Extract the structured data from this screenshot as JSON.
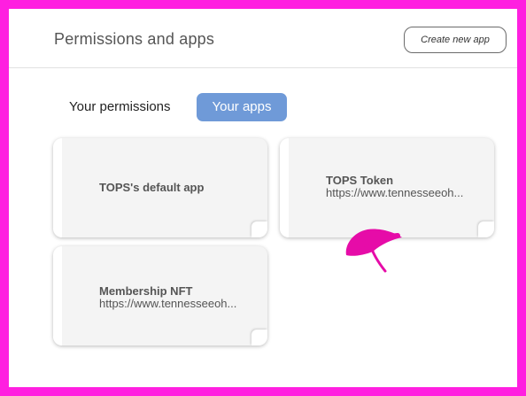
{
  "header": {
    "title": "Permissions and apps",
    "create_button": "Create new app"
  },
  "tabs": [
    {
      "label": "Your permissions",
      "active": false
    },
    {
      "label": "Your apps",
      "active": true
    }
  ],
  "apps": [
    {
      "name": "TOPS's default app",
      "url": ""
    },
    {
      "name": "TOPS Token",
      "url": "https://www.tennesseeoh..."
    },
    {
      "name": "Membership NFT",
      "url": "https://www.tennesseeoh..."
    }
  ],
  "colors": {
    "border_frame": "#ff1fe0",
    "active_tab": "#6f9ad8",
    "scribble": "#e60ca8"
  }
}
